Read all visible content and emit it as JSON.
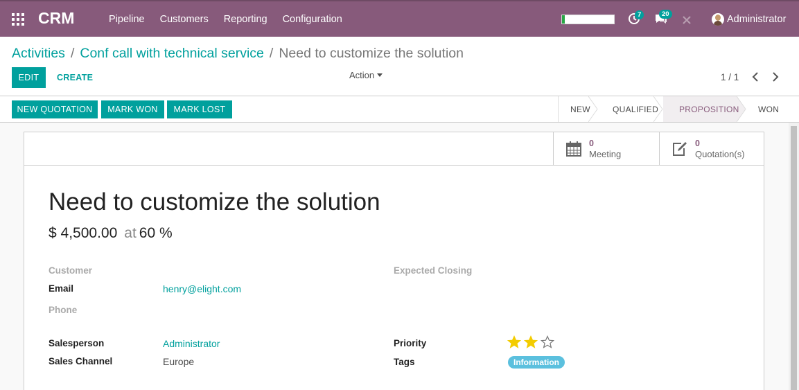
{
  "navbar": {
    "brand": "CRM",
    "menu": [
      "Pipeline",
      "Customers",
      "Reporting",
      "Configuration"
    ],
    "progress_fraction": 0.05,
    "activities_badge": "7",
    "messages_badge": "20",
    "user_name": "Administrator",
    "icons": [
      "apps-icon",
      "clock-icon",
      "chat-icon",
      "close-icon"
    ]
  },
  "breadcrumb": {
    "items": [
      "Activities",
      "Conf call with technical service"
    ],
    "separator": "/",
    "current": "Need to customize the solution"
  },
  "control_panel": {
    "edit_label": "EDIT",
    "create_label": "CREATE",
    "action_label": "Action",
    "pager": "1 / 1"
  },
  "statusbar": {
    "buttons": [
      "NEW QUOTATION",
      "MARK WON",
      "MARK LOST"
    ],
    "stages": [
      "NEW",
      "QUALIFIED",
      "PROPOSITION",
      "WON"
    ],
    "active_stage": "PROPOSITION"
  },
  "smart_buttons": [
    {
      "value": "0",
      "label": "Meeting",
      "icon": "calendar-icon"
    },
    {
      "value": "0",
      "label": "Quotation(s)",
      "icon": "edit-icon"
    }
  ],
  "form": {
    "title": "Need to customize the solution",
    "revenue": "$ 4,500.00",
    "at_label": "at",
    "probability": "60 %",
    "labels": {
      "customer": "Customer",
      "email": "Email",
      "phone": "Phone",
      "expected_closing": "Expected Closing",
      "salesperson": "Salesperson",
      "sales_channel": "Sales Channel",
      "priority": "Priority",
      "tags": "Tags"
    },
    "values": {
      "email": "henry@elight.com",
      "salesperson": "Administrator",
      "sales_channel": "Europe",
      "tag": "Information"
    },
    "priority_stars": 2,
    "priority_max": 3
  },
  "colors": {
    "navbar": "#875a7b",
    "primary": "#00a09d",
    "accent": "#875a7b",
    "star_on": "#f3cc00",
    "tag": "#5bc0de"
  }
}
